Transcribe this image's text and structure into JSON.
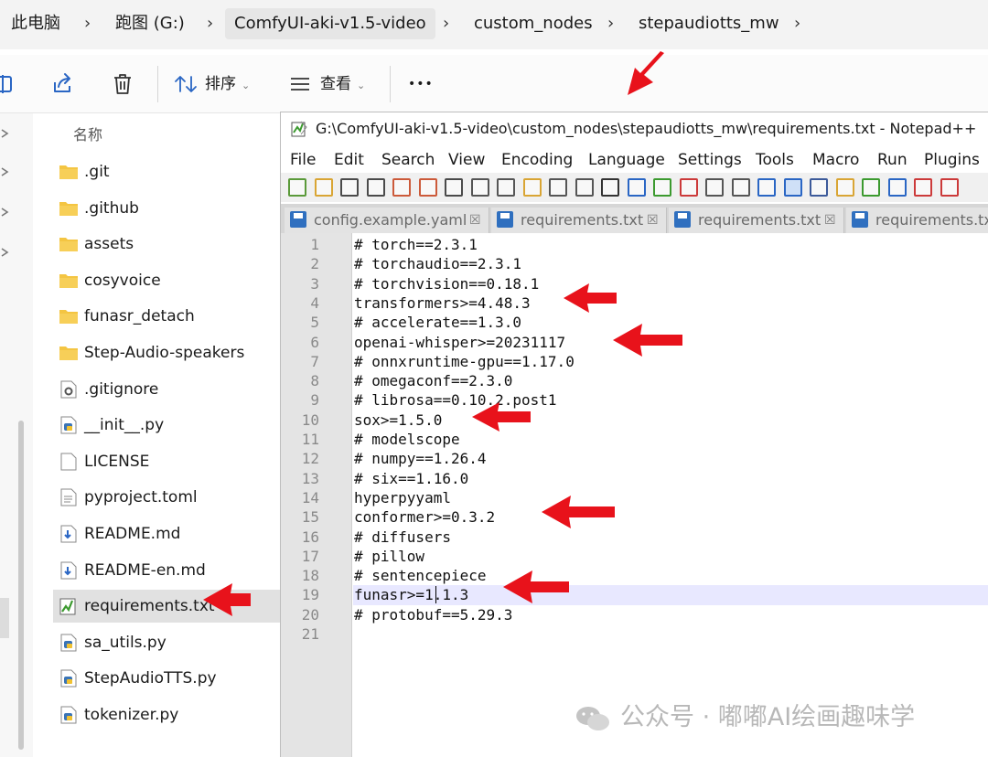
{
  "explorer": {
    "breadcrumbs": [
      "此电脑",
      "跑图 (G:)",
      "ComfyUI-aki-v1.5-video",
      "custom_nodes",
      "stepaudiotts_mw"
    ],
    "separator": "›",
    "toolbar": {
      "sort_label": "排序",
      "view_label": "查看",
      "more_label": "•••",
      "dropdown_glyph": "⌄"
    },
    "column_name": "名称",
    "files": [
      {
        "name": ".git",
        "type": "folder"
      },
      {
        "name": ".github",
        "type": "folder"
      },
      {
        "name": "assets",
        "type": "folder"
      },
      {
        "name": "cosyvoice",
        "type": "folder"
      },
      {
        "name": "funasr_detach",
        "type": "folder"
      },
      {
        "name": "Step-Audio-speakers",
        "type": "folder"
      },
      {
        "name": ".gitignore",
        "type": "config"
      },
      {
        "name": "__init__.py",
        "type": "python"
      },
      {
        "name": "LICENSE",
        "type": "file"
      },
      {
        "name": "pyproject.toml",
        "type": "text"
      },
      {
        "name": "README.md",
        "type": "markdown"
      },
      {
        "name": "README-en.md",
        "type": "markdown"
      },
      {
        "name": "requirements.txt",
        "type": "notepad",
        "selected": true
      },
      {
        "name": "sa_utils.py",
        "type": "python"
      },
      {
        "name": "StepAudioTTS.py",
        "type": "python"
      },
      {
        "name": "tokenizer.py",
        "type": "python"
      }
    ]
  },
  "notepad": {
    "title": "G:\\ComfyUI-aki-v1.5-video\\custom_nodes\\stepaudiotts_mw\\requirements.txt - Notepad++",
    "menu": [
      "File",
      "Edit",
      "Search",
      "View",
      "Encoding",
      "Language",
      "Settings",
      "Tools",
      "Macro",
      "Run",
      "Plugins"
    ],
    "tabs": [
      "config.example.yaml",
      "requirements.txt",
      "requirements.txt",
      "requirements.txt"
    ],
    "tab_close_glyph": "☒",
    "line_numbers": [
      "1",
      "2",
      "3",
      "4",
      "5",
      "6",
      "7",
      "8",
      "9",
      "10",
      "11",
      "12",
      "13",
      "14",
      "15",
      "16",
      "17",
      "18",
      "19",
      "20",
      "21"
    ],
    "lines": [
      "# torch==2.3.1",
      "# torchaudio==2.3.1",
      "# torchvision==0.18.1",
      "transformers>=4.48.3",
      "# accelerate==1.3.0",
      "openai-whisper>=20231117",
      "# onnxruntime-gpu==1.17.0",
      "# omegaconf==2.3.0",
      "# librosa==0.10.2.post1",
      "sox>=1.5.0",
      "# modelscope",
      "# numpy==1.26.4",
      "# six==1.16.0",
      "hyperpyyaml",
      "conformer>=0.3.2",
      "# diffusers",
      "# pillow",
      "# sentencepiece",
      "funasr>=1.1.3",
      "# protobuf==5.29.3",
      ""
    ],
    "current_line": 19
  },
  "watermark": "公众号 · 嘟嘟AI绘画趣味学",
  "colors": {
    "arrow": "#e8121b",
    "folder": "#f4c542",
    "current_line": "#e8e8ff"
  }
}
